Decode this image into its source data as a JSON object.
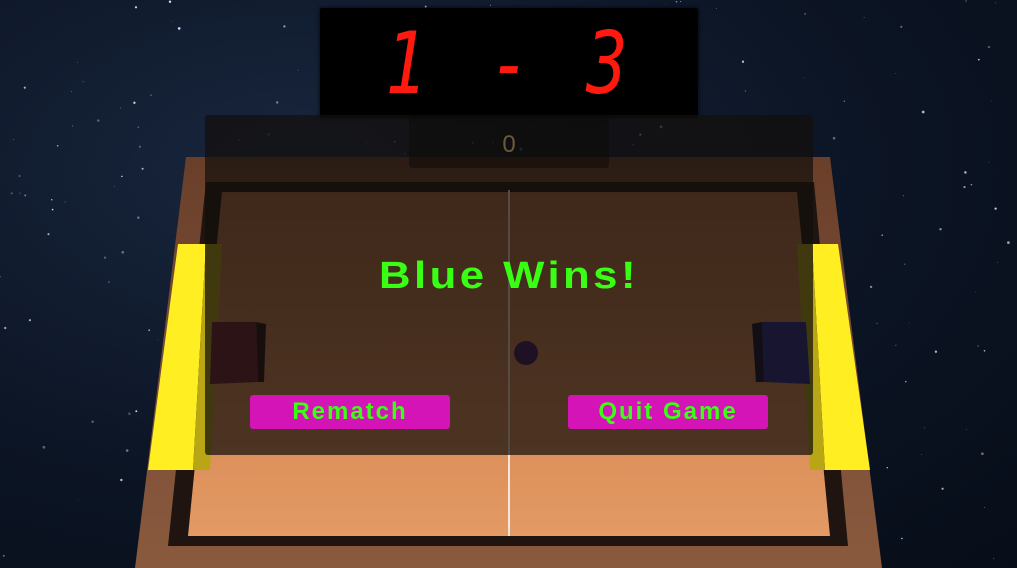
{
  "scoreboard": {
    "left_score": "1",
    "separator": "-",
    "right_score": "3",
    "digit_color": "#ff1a10"
  },
  "timer": "0",
  "result": {
    "message": "Blue Wins!",
    "text_color": "#39ff14"
  },
  "buttons": {
    "rematch": "Rematch",
    "quit": "Quit Game",
    "button_color": "#d414b6"
  },
  "colors": {
    "table_floor": "#d98a55",
    "table_rail": "#7a4a2f",
    "goal_stripe": "#ffee22",
    "paddle_red": "#5a1b28",
    "paddle_blue": "#1c1f6e",
    "puck": "#2a0f45"
  }
}
